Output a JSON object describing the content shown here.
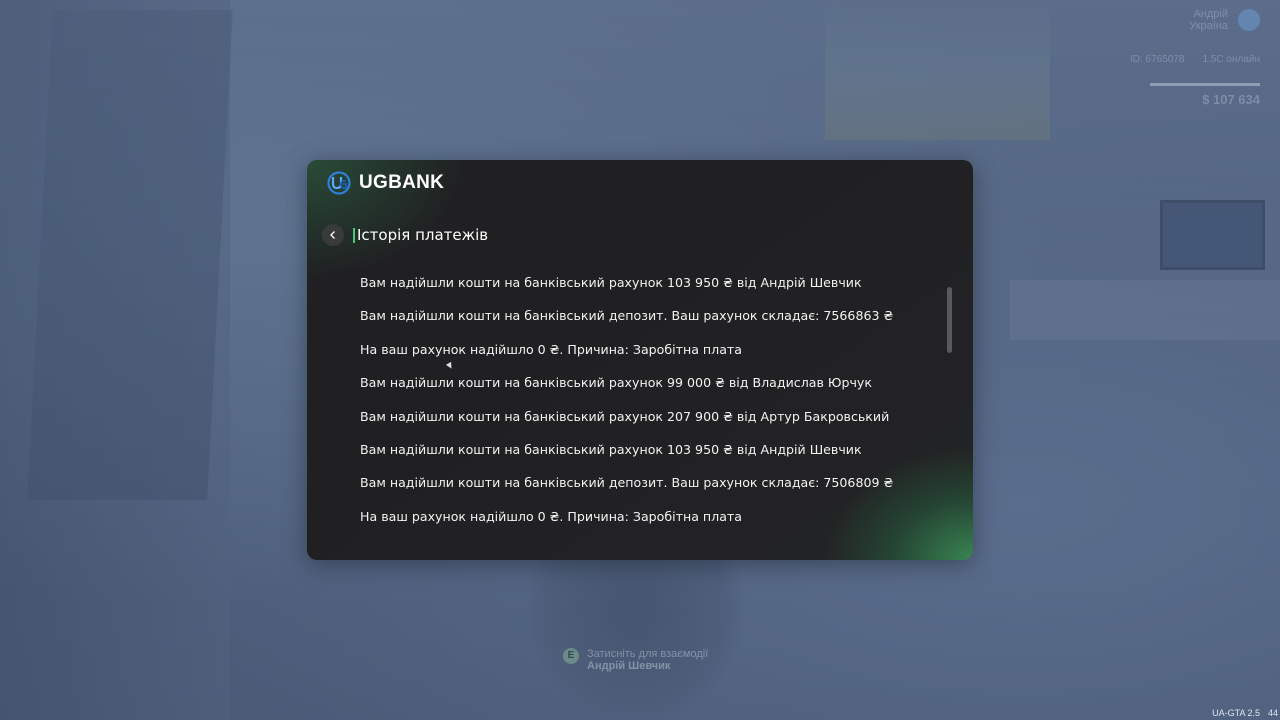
{
  "hud": {
    "player_name": "Андрій\nУкраїна",
    "id_text": "ID: 6765078",
    "level_text": "1.5С онлайн",
    "health": "100",
    "armor": "100",
    "money": "$ 107 634"
  },
  "bank": {
    "brand": "UGBANK",
    "title": "Історія платежів",
    "transactions": [
      "Вам надійшли кошти на банківський рахунок 103 950 ₴ від Андрій Шевчик",
      "Вам надійшли кошти на банківський депозит. Ваш рахунок складає: 7566863 ₴",
      "На ваш рахунок надійшло 0 ₴. Причина: Заробітна плата",
      "Вам надійшли кошти на банківський рахунок 99 000 ₴ від Владислав Юрчук",
      "Вам надійшли кошти на банківський рахунок 207 900 ₴ від Артур Бакровський",
      "Вам надійшли кошти на банківський рахунок 103 950 ₴ від Андрій Шевчик",
      "Вам надійшли кошти на банківський депозит. Ваш рахунок складає: 7506809 ₴",
      "На ваш рахунок надійшло 0 ₴. Причина: Заробітна плата"
    ]
  },
  "hint": {
    "key": "E",
    "text": "Затисніть для взаємодії",
    "name": "Андрій Шевчик"
  },
  "version": "UA-GTA 2.5",
  "fps": "44",
  "colors": {
    "accent": "#4cc77b",
    "panel_bg": "#202022",
    "text": "#f2f2f2"
  }
}
